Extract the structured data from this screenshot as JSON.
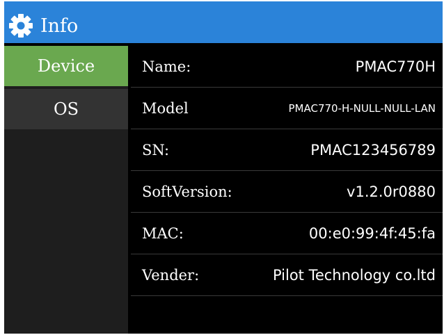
{
  "window": {
    "title": "Info",
    "title_bar_color": "#2b83d9",
    "icon": "gear-icon"
  },
  "sidebar": {
    "items": [
      {
        "label": "Device",
        "active": true,
        "color": "#6aa84f"
      },
      {
        "label": "OS",
        "active": false,
        "color": "#333333"
      }
    ]
  },
  "info": {
    "rows": [
      {
        "label": "Name:",
        "value": "PMAC770H"
      },
      {
        "label": "Model",
        "value": "PMAC770-H-NULL-NULL-LAN"
      },
      {
        "label": "SN:",
        "value": "PMAC123456789"
      },
      {
        "label": "SoftVersion:",
        "value": "v1.2.0r0880"
      },
      {
        "label": "MAC:",
        "value": "00:e0:99:4f:45:fa"
      },
      {
        "label": "Vender:",
        "value": "Pilot Technology co.ltd"
      }
    ]
  }
}
